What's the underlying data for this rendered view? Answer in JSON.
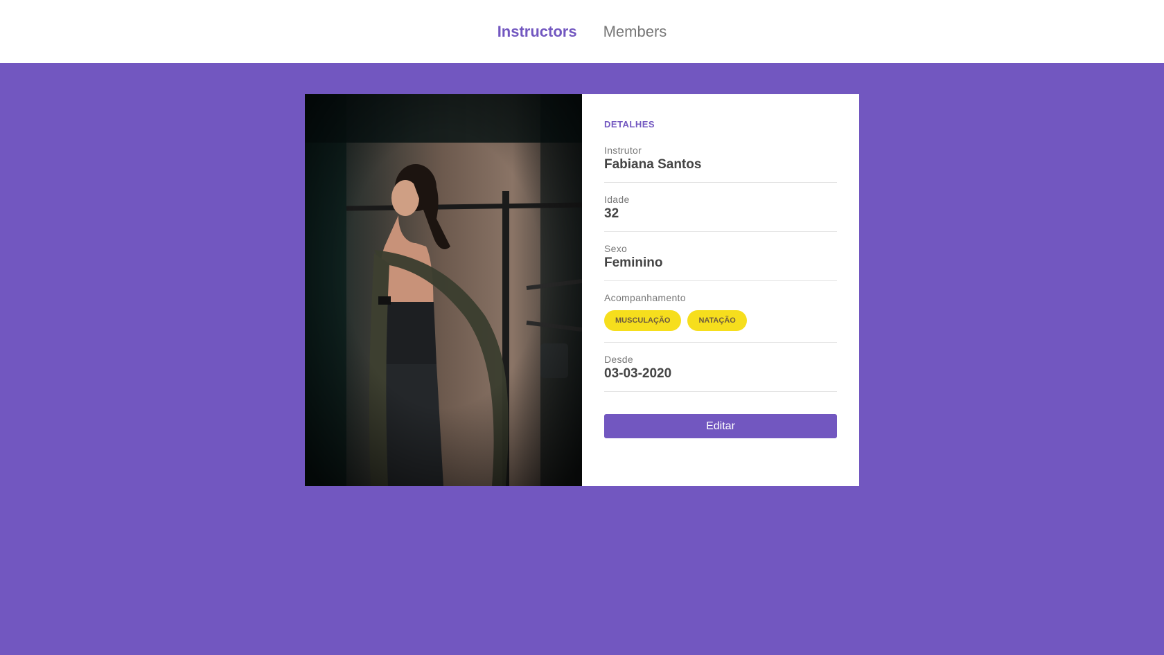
{
  "nav": {
    "items": [
      {
        "label": "Instructors",
        "active": true
      },
      {
        "label": "Members",
        "active": false
      }
    ]
  },
  "details": {
    "section_title": "DETALHES",
    "fields": {
      "instructor": {
        "label": "Instrutor",
        "value": "Fabiana Santos"
      },
      "age": {
        "label": "Idade",
        "value": "32"
      },
      "gender": {
        "label": "Sexo",
        "value": "Feminino"
      },
      "services": {
        "label": "Acompanhamento",
        "tags": [
          "MUSCULAÇÃO",
          "NATAÇÃO"
        ]
      },
      "since": {
        "label": "Desde",
        "value": "03-03-2020"
      }
    },
    "edit_label": "Editar"
  },
  "colors": {
    "accent": "#7257c0",
    "tag_bg": "#f6de1d"
  }
}
